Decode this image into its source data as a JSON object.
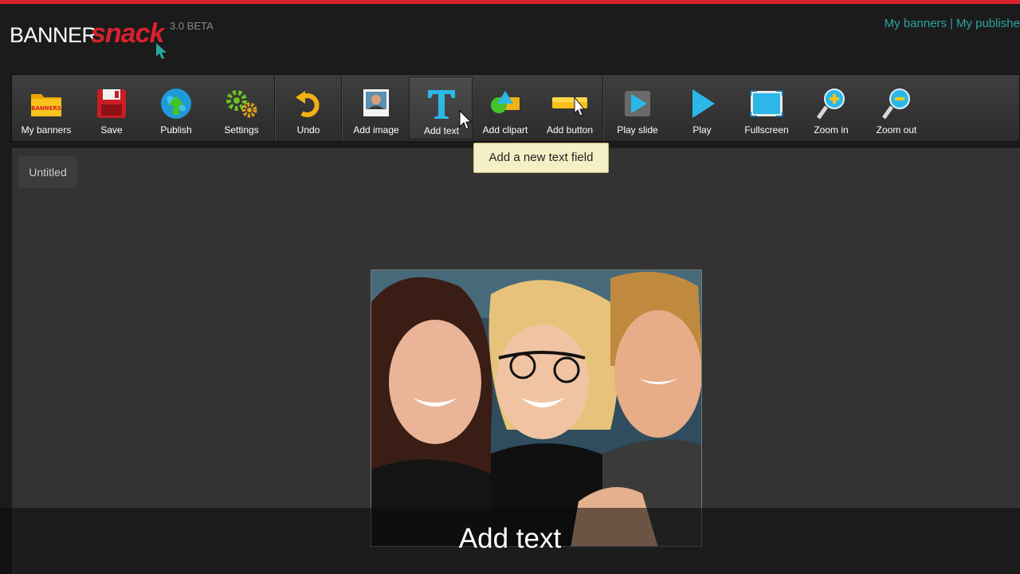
{
  "app": {
    "logo_part1": "BANNER",
    "logo_part2": "snack",
    "version": "3.0 BETA",
    "accent": "#d8222c",
    "link_color": "#2aa5a0"
  },
  "topnav": {
    "items": [
      "My banners",
      "My publishe"
    ],
    "separator": "|"
  },
  "toolbar": {
    "groups": [
      [
        {
          "label": "My banners",
          "icon": "folder-icon"
        },
        {
          "label": "Save",
          "icon": "floppy-icon"
        },
        {
          "label": "Publish",
          "icon": "globe-upload-icon"
        },
        {
          "label": "Settings",
          "icon": "gears-icon"
        }
      ],
      [
        {
          "label": "Undo",
          "icon": "undo-icon"
        }
      ],
      [
        {
          "label": "Add image",
          "icon": "image-icon"
        },
        {
          "label": "Add text",
          "icon": "text-icon"
        },
        {
          "label": "Add clipart",
          "icon": "shapes-icon"
        },
        {
          "label": "Add button",
          "icon": "button-icon"
        }
      ],
      [
        {
          "label": "Play slide",
          "icon": "play-slide-icon"
        },
        {
          "label": "Play",
          "icon": "play-icon"
        },
        {
          "label": "Fullscreen",
          "icon": "fullscreen-icon"
        },
        {
          "label": "Zoom in",
          "icon": "zoom-in-icon"
        },
        {
          "label": "Zoom out",
          "icon": "zoom-out-icon"
        }
      ]
    ],
    "active": "Add text"
  },
  "tooltip": {
    "text": "Add a new text field"
  },
  "document": {
    "tab_label": "Untitled"
  },
  "caption": {
    "text": "Add text"
  }
}
